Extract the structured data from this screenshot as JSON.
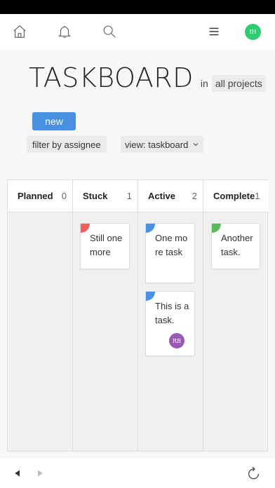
{
  "header": {
    "title": "TASKBOARD",
    "in_label": "in",
    "project": "all projects",
    "user_initials": "IH",
    "user_color": "#2ecc71"
  },
  "toolbar": {
    "new_label": "new",
    "filter_label": "filter by assignee",
    "view_label": "view: taskboard"
  },
  "columns": [
    {
      "name": "Planned",
      "count": "0"
    },
    {
      "name": "Stuck",
      "count": "1"
    },
    {
      "name": "Active",
      "count": "2"
    },
    {
      "name": "Complete",
      "count": "1"
    }
  ],
  "cards": {
    "stuck": {
      "text": "Still one more",
      "color": "#f25f5c"
    },
    "active_1": {
      "text": "One more task",
      "color": "#4a90e2"
    },
    "active_2": {
      "text": "This is a task.",
      "color": "#4a90e2",
      "assignee": "RB",
      "assignee_color": "#9b59b6"
    },
    "complete": {
      "text": "Another task.",
      "color": "#5cb85c"
    }
  },
  "icons": {
    "nav": [
      "home-icon",
      "bell-icon",
      "search-icon",
      "menu-icon"
    ],
    "bottom": [
      "back-arrow-icon",
      "forward-arrow-icon",
      "refresh-icon"
    ]
  }
}
